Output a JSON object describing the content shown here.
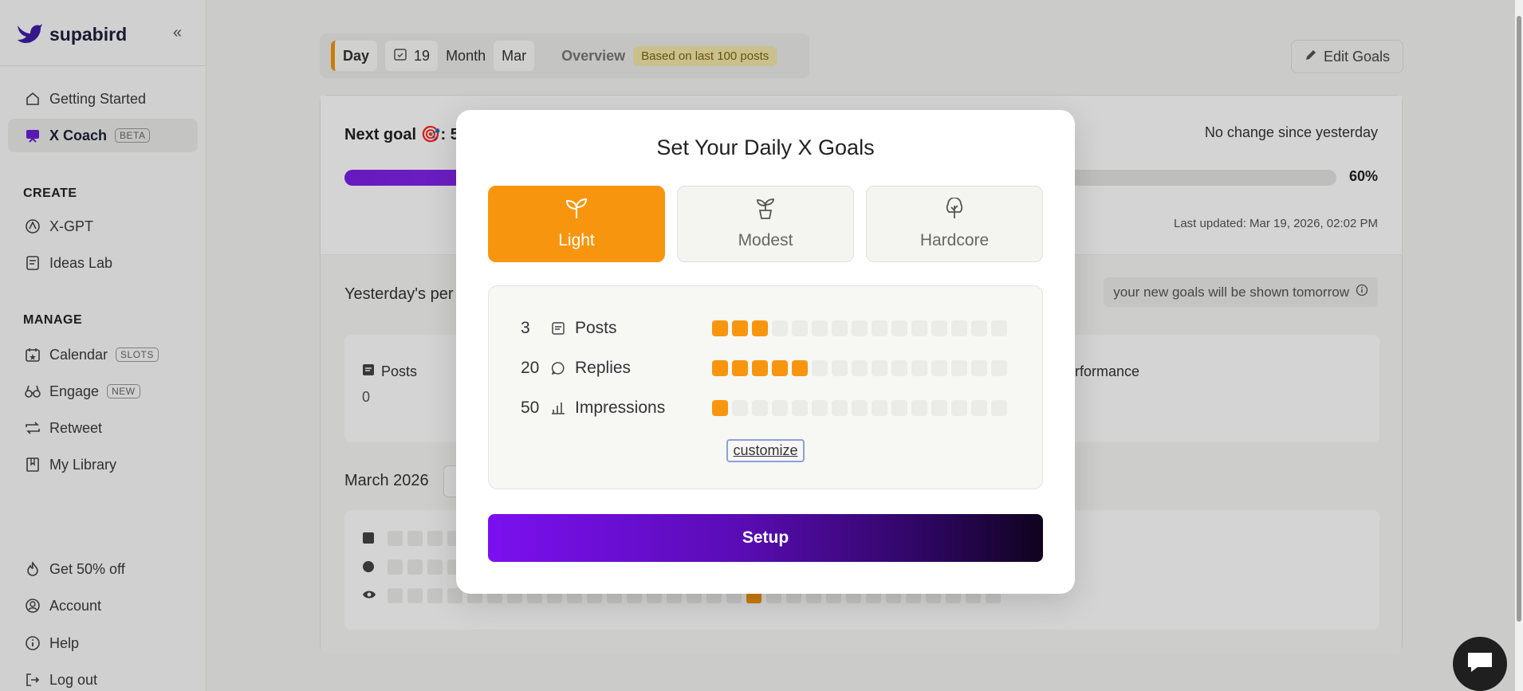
{
  "brand": {
    "name": "supabird"
  },
  "sidebar": {
    "items_top": [
      {
        "label": "Getting Started",
        "icon": "home-icon"
      },
      {
        "label": "X Coach",
        "tag": "BETA",
        "icon": "coach-icon"
      }
    ],
    "create_label": "CREATE",
    "create_items": [
      {
        "label": "X-GPT",
        "icon": "gpt-icon"
      },
      {
        "label": "Ideas Lab",
        "icon": "note-icon"
      }
    ],
    "manage_label": "MANAGE",
    "manage_items": [
      {
        "label": "Calendar",
        "tag": "SLOTS",
        "icon": "calendar-star-icon"
      },
      {
        "label": "Engage",
        "tag": "NEW",
        "icon": "binoculars-icon"
      },
      {
        "label": "Retweet",
        "icon": "retweet-icon"
      },
      {
        "label": "My Library",
        "icon": "bookmark-icon"
      }
    ],
    "bottom_items": [
      {
        "label": "Get 50% off",
        "icon": "flame-icon"
      },
      {
        "label": "Account",
        "icon": "user-icon"
      },
      {
        "label": "Help",
        "icon": "info-icon"
      },
      {
        "label": "Log out",
        "icon": "logout-icon"
      }
    ]
  },
  "topbar": {
    "day": "Day",
    "date": "19",
    "month_label": "Month",
    "month_value": "Mar",
    "overview": "Overview",
    "based": "Based on last 100 posts",
    "edit_goals": "Edit Goals"
  },
  "card": {
    "next_goal": "Next goal 🎯: 5",
    "no_change": "No change since yesterday",
    "progress": 0.6,
    "progress_label": "60%",
    "last_updated": "Last updated: Mar 19, 2026, 02:02 PM",
    "yesterday_perf": "Yesterday's per",
    "new_goals_note": "your new goals will be shown tomorrow",
    "posts_label": "Posts",
    "posts_value": "0",
    "performance_label": "erformance",
    "month_title": "March 2026"
  },
  "modal": {
    "title": "Set Your Daily X Goals",
    "options": [
      {
        "label": "Light",
        "icon": "sprout-icon",
        "selected": true
      },
      {
        "label": "Modest",
        "icon": "plant-pot-icon",
        "selected": false
      },
      {
        "label": "Hardcore",
        "icon": "tree-icon",
        "selected": false
      }
    ],
    "goals": [
      {
        "value": "3",
        "label": "Posts",
        "icon": "post-icon",
        "filled": 3,
        "total": 15
      },
      {
        "value": "20",
        "label": "Replies",
        "icon": "reply-icon",
        "filled": 5,
        "total": 15
      },
      {
        "value": "50",
        "label": "Impressions",
        "icon": "chart-icon",
        "filled": 1,
        "total": 15
      }
    ],
    "customize": "customize",
    "setup": "Setup"
  },
  "colors": {
    "accent_orange": "#f7960e",
    "accent_purple": "#7b10f0"
  }
}
